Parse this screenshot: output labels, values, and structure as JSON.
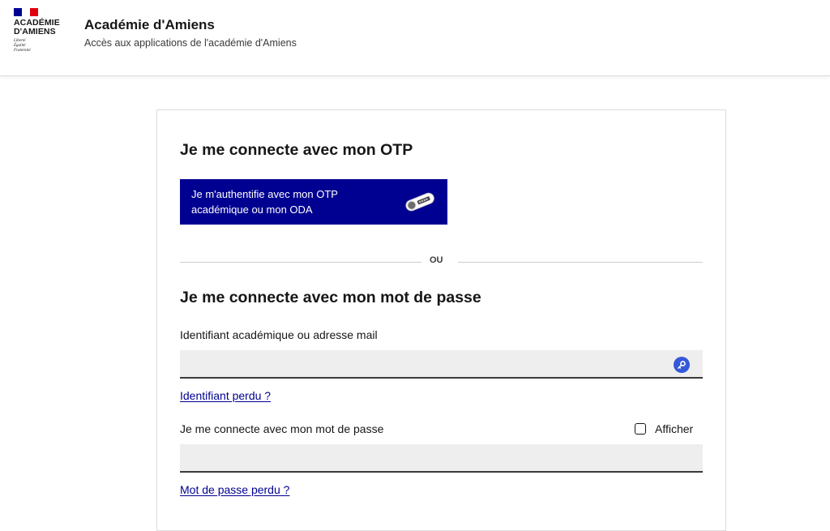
{
  "header": {
    "logo": {
      "name": "ACADÉMIE\nD'AMIENS",
      "motto": "Liberté\nÉgalité\nFraternité"
    },
    "title": "Académie d'Amiens",
    "tagline": "Accès aux applications de l'académie d'Amiens"
  },
  "otp_section": {
    "title": "Je me connecte avec mon OTP",
    "button_label": "Je m'authentifie avec mon OTP académique ou mon ODA",
    "button_icon": "otp-key-token-icon"
  },
  "separator": {
    "text": "OU"
  },
  "password_section": {
    "title": "Je me connecte avec mon mot de passe",
    "identifier": {
      "label": "Identifiant académique ou adresse mail",
      "value": "",
      "icon": "key-icon",
      "forgot_link": "Identifiant perdu ?"
    },
    "password": {
      "label": "Je me connecte avec mon mot de passe",
      "value": "",
      "show_label": "Afficher",
      "show_checked": false,
      "forgot_link": "Mot de passe perdu ?"
    }
  },
  "colors": {
    "primary_blue": "#000091",
    "flag_red": "#e1000f",
    "input_bg": "#eeeeee",
    "key_badge": "#3558d8"
  }
}
